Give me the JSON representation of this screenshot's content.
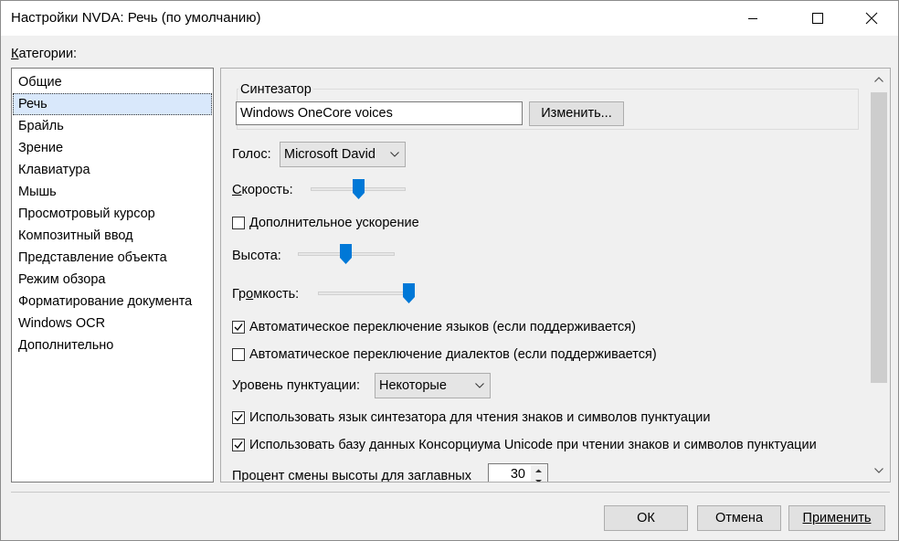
{
  "window": {
    "title": "Настройки NVDA: Речь (по умолчанию)"
  },
  "categories": {
    "label_prefix": "К",
    "label_rest": "атегории:",
    "items": [
      "Общие",
      "Речь",
      "Брайль",
      "Зрение",
      "Клавиатура",
      "Мышь",
      "Просмотровый курсор",
      "Композитный ввод",
      "Представление объекта",
      "Режим обзора",
      "Форматирование документа",
      "Windows OCR",
      "Дополнительно"
    ],
    "selected": "Речь"
  },
  "speech": {
    "synth_group_label": "Синтезатор",
    "synth_value": "Windows OneCore voices",
    "change_button": "Изменить...",
    "voice_label": "Голос:",
    "voice_value": "Microsoft David",
    "rate_label_a": "С",
    "rate_label_b": "корость:",
    "rate_level": 0.5,
    "rate_boost_label": "Дополнительное ускорение",
    "rate_boost_checked": false,
    "pitch_label": "Высота:",
    "pitch_level": 0.5,
    "volume_label_a": "Гр",
    "volume_label_b": "о",
    "volume_label_c": "мкость:",
    "volume_level": 1.0,
    "auto_lang_label": "Автоматическое переключение языков (если поддерживается)",
    "auto_lang_checked": true,
    "auto_dialect_label": "Автоматическое переключение диалектов (если поддерживается)",
    "auto_dialect_checked": false,
    "punct_label": "Уровень пунктуации:",
    "punct_value": "Некоторые",
    "use_synth_lang_label": "Использовать язык синтезатора для чтения знаков и символов пунктуации",
    "use_synth_lang_checked": true,
    "use_cldr_label": "Использовать базу данных Консорциума Unicode при чтении знаков и символов пунктуации",
    "use_cldr_checked": true,
    "cap_pitch_label": "Процент смены высоты для заглавных",
    "cap_pitch_value": "30"
  },
  "footer": {
    "ok": "ОК",
    "cancel": "Отмена",
    "apply": "Применить"
  },
  "colors": {
    "slider_thumb": "#0078d7",
    "selection": "#d9e8fb"
  }
}
